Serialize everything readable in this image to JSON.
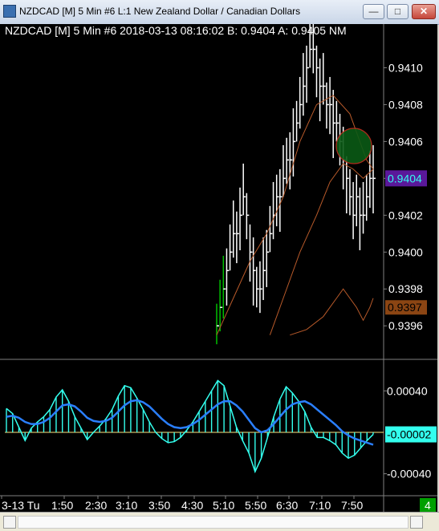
{
  "window": {
    "title": "NZDCAD [M]  5 Min   #6  L:1  New Zealand Dollar / Canadian Dollars",
    "minimize_glyph": "—",
    "maximize_glyph": "□",
    "close_glyph": "✕"
  },
  "chart_header": "NZDCAD [M]   5 Min    #6 2018-03-13 08:16:02 B: 0.9404  A: 0.9405 NM",
  "colors": {
    "background": "#000000",
    "up_bar": "#ffffff",
    "green_bar": "#00c000",
    "ma_line": "#b85a2a",
    "histogram": "#33ffee",
    "signal_line": "#2a7fff",
    "bid_tag": "#5a189a",
    "marker_tag": "#8b4513",
    "osc_tag": "#33ffee",
    "bars_label_bg": "#00a000"
  },
  "chart_data": [
    {
      "type": "line",
      "panel": "price",
      "y_ticks": [
        "0.9410",
        "0.9408",
        "0.9406",
        "0.9404",
        "0.9402",
        "0.9400",
        "0.9398",
        "0.9396"
      ],
      "ylim": [
        0.93954,
        0.94115
      ],
      "bid_label": "0.9404",
      "marker_label": "0.9397",
      "series": [
        {
          "x": [
            0,
            1,
            2,
            3,
            4,
            5,
            6,
            7,
            8,
            9,
            10,
            11,
            12,
            13,
            14,
            15,
            16,
            17,
            18,
            19,
            20,
            21,
            22,
            23,
            24,
            25,
            26,
            27,
            28,
            29,
            30,
            31,
            32,
            33,
            34,
            35,
            36,
            37,
            38,
            39,
            40,
            41,
            42,
            43,
            44,
            45,
            46,
            47
          ],
          "values": [
            0.9396,
            0.9397,
            0.9398,
            0.9399,
            0.94,
            0.9401,
            0.9401,
            0.9402,
            0.9403,
            0.9402,
            0.94,
            0.9399,
            0.9398,
            0.9398,
            0.9399,
            0.94,
            0.9401,
            0.9402,
            0.9403,
            0.9403,
            0.9404,
            0.9405,
            0.9405,
            0.9406,
            0.9407,
            0.9408,
            0.9409,
            0.941,
            0.9411,
            0.9411,
            0.941,
            0.9409,
            0.9409,
            0.9408,
            0.9408,
            0.9407,
            0.9407,
            0.9406,
            0.9405,
            0.9404,
            0.9403,
            0.9402,
            0.9403,
            0.9402,
            0.9402,
            0.9403,
            0.9404,
            0.9404
          ]
        },
        {
          "x": [
            0,
            5,
            10,
            15,
            20,
            25,
            30,
            35,
            40,
            45,
            47
          ],
          "values": [
            0.93955,
            0.93975,
            0.93995,
            0.9401,
            0.9403,
            0.9406,
            0.9408,
            0.94085,
            0.94075,
            0.9405,
            0.94045
          ]
        },
        {
          "x": [
            16,
            20,
            25,
            30,
            34,
            38,
            41,
            44,
            47
          ],
          "values": [
            0.93955,
            0.93975,
            0.94,
            0.9402,
            0.94038,
            0.94048,
            0.94045,
            0.9404,
            0.94045
          ]
        },
        {
          "x": [
            22,
            27,
            32,
            36,
            38,
            40,
            42,
            44,
            46,
            47
          ],
          "values": [
            0.93955,
            0.93958,
            0.93965,
            0.93975,
            0.9398,
            0.93975,
            0.9397,
            0.93963,
            0.9397,
            0.93975
          ]
        }
      ]
    },
    {
      "type": "bar",
      "panel": "oscillator",
      "y_ticks": [
        "0.00040",
        "-0.00040"
      ],
      "ylim": [
        -0.00055,
        0.00065
      ],
      "current_label": "-0.00002",
      "values": [
        0.00023,
        0.00018,
        5e-05,
        -8e-05,
        4e-05,
        0.0001,
        0.00015,
        0.00022,
        0.00034,
        0.00041,
        0.0003,
        0.00015,
        4e-05,
        -7e-05,
        0.0,
        6e-05,
        0.00013,
        0.00022,
        0.00035,
        0.00045,
        0.00043,
        0.00033,
        0.00022,
        0.0001,
        0.0,
        -6e-05,
        -0.0001,
        -9e-05,
        -5e-05,
        2e-05,
        0.0001,
        0.0002,
        0.0003,
        0.0004,
        0.0005,
        0.00045,
        0.00025,
        5e-05,
        -8e-05,
        -0.0002,
        -0.00038,
        -0.00025,
        -5e-05,
        0.00015,
        0.00032,
        0.00044,
        0.00038,
        0.0003,
        0.0002,
        5e-05,
        -5e-05,
        -5e-05,
        -8e-05,
        -0.00012,
        -0.0002,
        -0.00025,
        -0.00022,
        -0.00015,
        -8e-05,
        -2e-05
      ],
      "signal": [
        0.00015,
        0.00016,
        0.00014,
        0.0001,
        8e-05,
        8e-05,
        0.0001,
        0.00014,
        0.0002,
        0.00026,
        0.00027,
        0.00025,
        0.0002,
        0.00014,
        0.00011,
        0.0001,
        0.00011,
        0.00014,
        0.0002,
        0.00026,
        0.0003,
        0.00031,
        0.00029,
        0.00025,
        0.00019,
        0.00013,
        8e-05,
        5e-05,
        4e-05,
        5e-05,
        8e-05,
        0.00012,
        0.00017,
        0.00022,
        0.00027,
        0.0003,
        0.0003,
        0.00026,
        0.0002,
        0.00012,
        4e-05,
        0.0,
        2e-05,
        8e-05,
        0.00015,
        0.00022,
        0.00027,
        0.00029,
        0.0003,
        0.00027,
        0.00022,
        0.00017,
        0.00012,
        7e-05,
        1e-05,
        -3e-05,
        -6e-05,
        -8e-05,
        -0.0001,
        -0.00012
      ]
    }
  ],
  "x_axis": {
    "labels": [
      "3-13 Tu",
      "1:50",
      "2:30",
      "3:10",
      "3:50",
      "4:30",
      "5:10",
      "5:50",
      "6:30",
      "7:10",
      "7:50"
    ]
  },
  "status": {
    "bars_count": "4"
  }
}
